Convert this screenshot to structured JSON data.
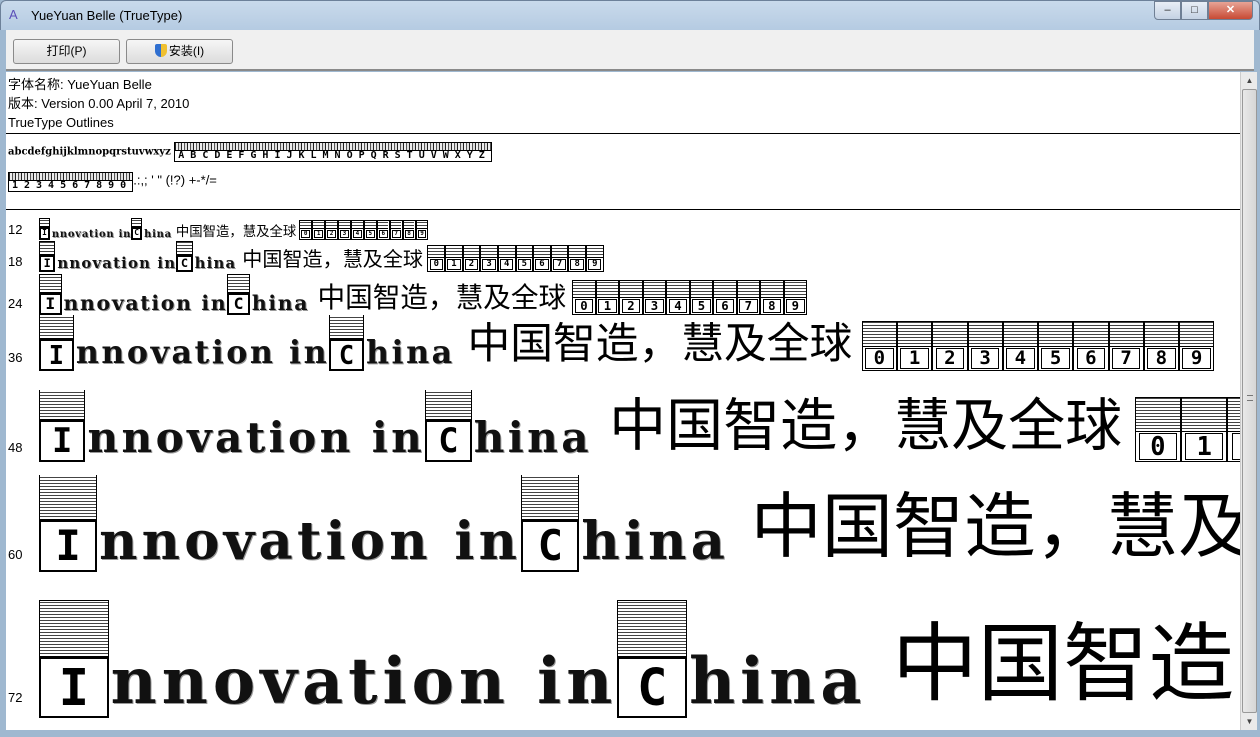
{
  "window": {
    "title": "YueYuan  Belle (TrueType)",
    "minimize": "–",
    "maximize": "□",
    "close": "✕"
  },
  "toolbar": {
    "print_label": "打印(P)",
    "install_label": "安装(I)"
  },
  "info": {
    "name_line": "字体名称: YueYuan  Belle",
    "version_line": "版本: Version 0.00 April 7, 2010",
    "type_line": "TrueType Outlines"
  },
  "charset": {
    "lowercase": "abcdefghijklmnopqrstuvwxyz",
    "uppercase": "ABCDEFGHIJKLMNOPQRSTUVWXYZ",
    "digits": "1234567890",
    "punct": ".:,; ' \" (!?) +-*/="
  },
  "sample": {
    "cap1": "I",
    "rest1": "nnovation in ",
    "cap2": "C",
    "rest2": "hina",
    "cjk": "中国智造，慧及全球",
    "digits": [
      "0",
      "1",
      "2",
      "3",
      "4",
      "5",
      "6",
      "7",
      "8",
      "9"
    ]
  },
  "sizes": [
    "12",
    "18",
    "24",
    "36",
    "48",
    "60",
    "72"
  ]
}
